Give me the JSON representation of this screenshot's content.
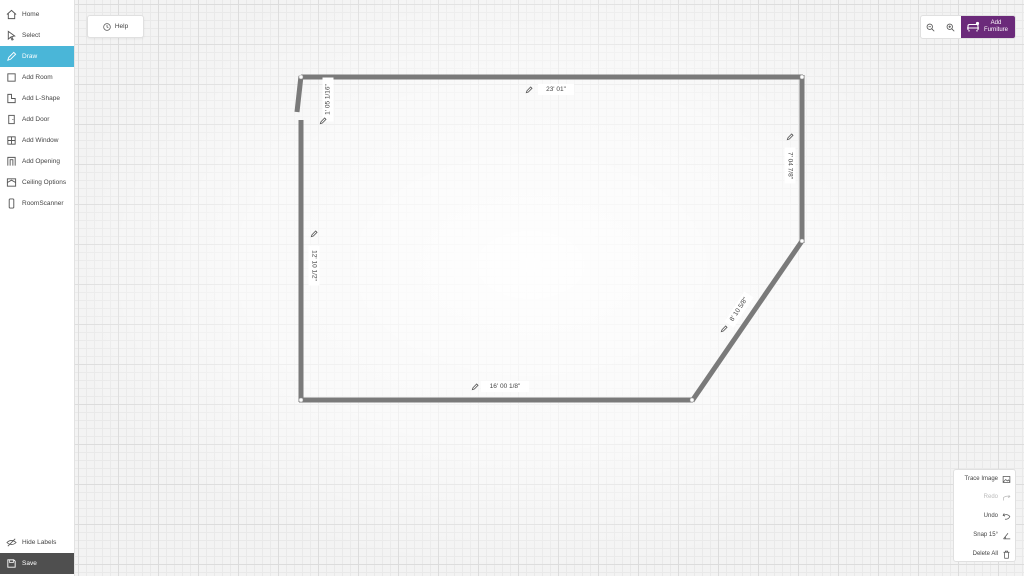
{
  "sidebar": {
    "items": [
      {
        "label": "Home",
        "icon": "home-icon",
        "active": false
      },
      {
        "label": "Select",
        "icon": "cursor-icon",
        "active": false
      },
      {
        "label": "Draw",
        "icon": "pencil-icon",
        "active": true
      },
      {
        "label": "Add Room",
        "icon": "square-icon",
        "active": false
      },
      {
        "label": "Add L-Shape",
        "icon": "l-shape-icon",
        "active": false
      },
      {
        "label": "Add Door",
        "icon": "door-icon",
        "active": false
      },
      {
        "label": "Add Window",
        "icon": "window-icon",
        "active": false
      },
      {
        "label": "Add Opening",
        "icon": "opening-icon",
        "active": false
      },
      {
        "label": "Ceiling Options",
        "icon": "ceiling-icon",
        "active": false
      },
      {
        "label": "RoomScanner",
        "icon": "phone-icon",
        "active": false
      }
    ],
    "hide_labels": "Hide Labels",
    "save": "Save"
  },
  "toolbar": {
    "help": "Help",
    "add_furniture": "Add\nFurniture"
  },
  "walls": {
    "top": "23' 01\"",
    "left_short": "1' 05 1/16\"",
    "left": "12' 10 1/2\"",
    "right": "7' 04 7/8\"",
    "diagonal": "8' 10 5/8\"",
    "bottom": "16' 00 1/8\""
  },
  "tools": {
    "trace_image": "Trace Image",
    "redo": "Redo",
    "undo": "Undo",
    "snap": "Snap 15°",
    "delete_all": "Delete All"
  },
  "colors": {
    "accent": "#4ab6d8",
    "brand": "#6b2a7a",
    "wall": "#7a7a7a",
    "save_bg": "#4f4f4f"
  }
}
